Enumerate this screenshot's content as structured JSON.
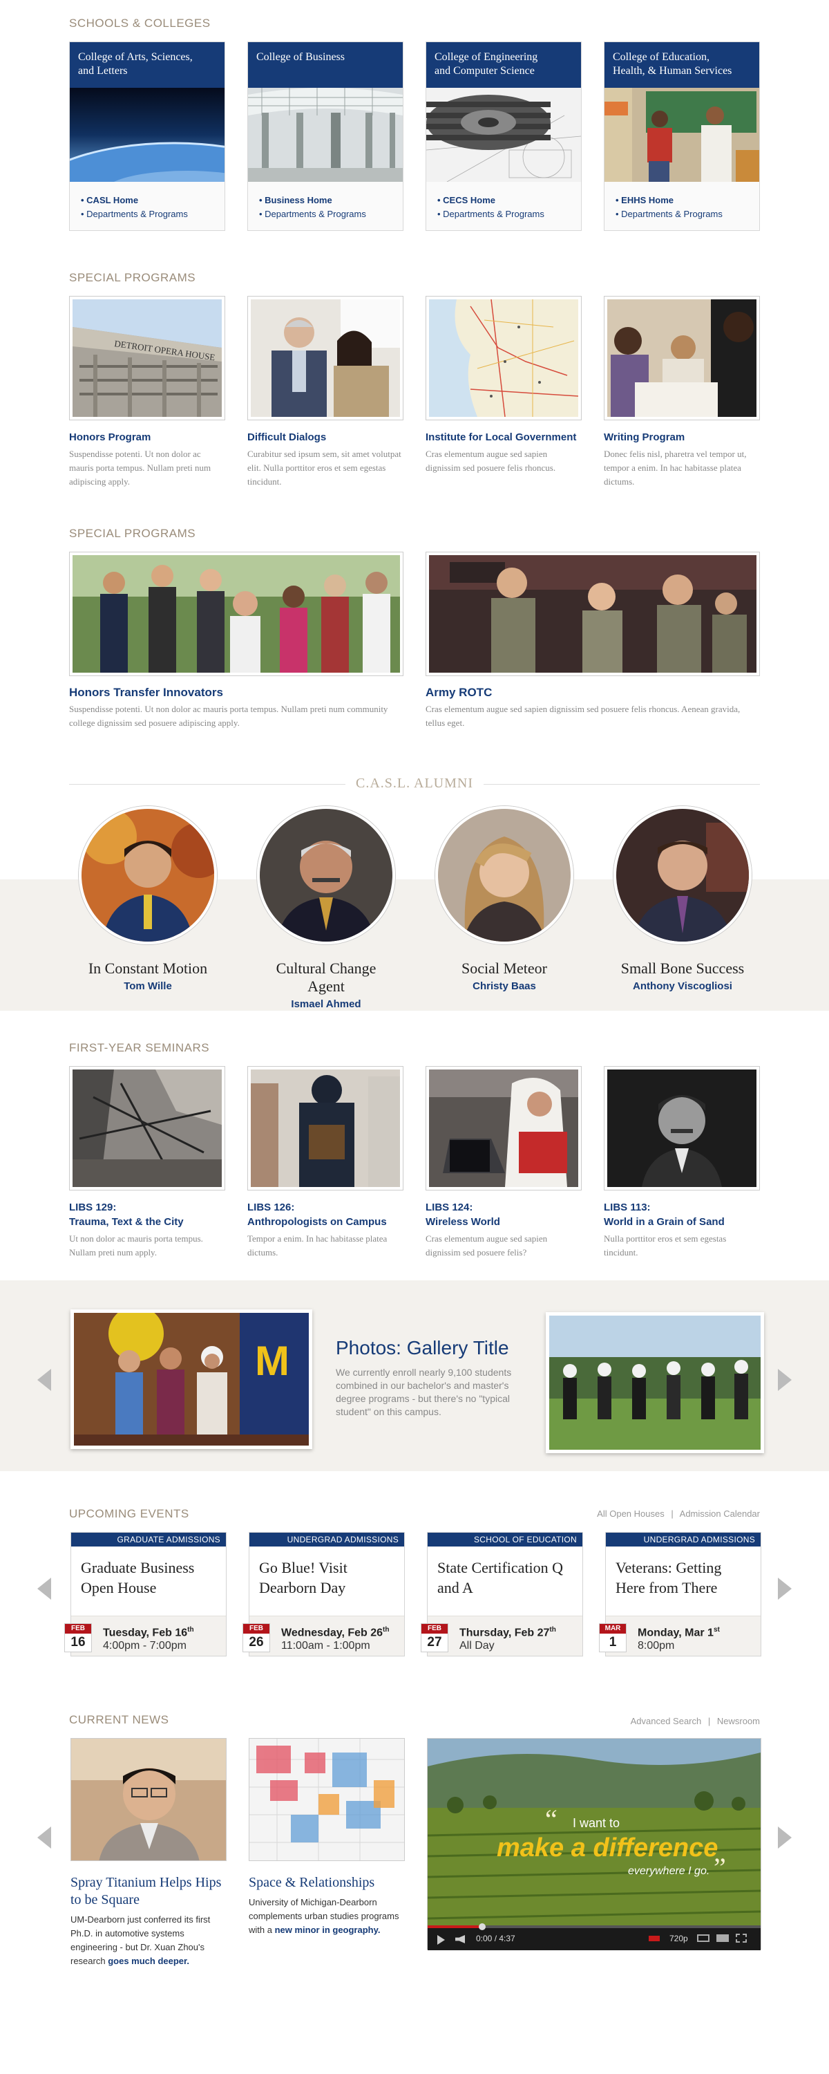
{
  "schools": {
    "label": "SCHOOLS & COLLEGES",
    "items": [
      {
        "title_line1": "College of Arts, Sciences,",
        "title_line2": "and Letters",
        "home": "CASL Home",
        "dept": "Departments & Programs"
      },
      {
        "title_line1": "College of Business",
        "title_line2": "",
        "home": "Business Home",
        "dept": "Departments & Programs"
      },
      {
        "title_line1": "College of Engineering",
        "title_line2": "and Computer Science",
        "home": "CECS Home",
        "dept": "Departments & Programs"
      },
      {
        "title_line1": "College of Education,",
        "title_line2": "Health, & Human Services",
        "home": "EHHS Home",
        "dept": "Departments & Programs"
      }
    ]
  },
  "special1": {
    "label": "SPECIAL PROGRAMS",
    "items": [
      {
        "title": "Honors Program",
        "desc": "Suspendisse potenti. Ut non dolor ac mauris porta tempus. Nullam preti num adipiscing apply."
      },
      {
        "title": "Difficult Dialogs",
        "desc": "Curabitur sed ipsum sem, sit amet volutpat elit. Nulla porttitor eros et sem egestas tincidunt."
      },
      {
        "title": "Institute for Local Government",
        "desc": "Cras elementum augue sed sapien dignissim sed posuere felis rhoncus."
      },
      {
        "title": "Writing Program",
        "desc": "Donec felis nisl, pharetra vel tempor ut, tempor a enim. In hac habitasse platea dictums."
      }
    ],
    "photo_sign": "DETROIT OPERA HOUSE"
  },
  "special2": {
    "label": "SPECIAL PROGRAMS",
    "items": [
      {
        "title": "Honors Transfer Innovators",
        "desc": "Suspendisse potenti. Ut non dolor ac mauris porta tempus. Nullam preti num community college dignissim sed posuere adipiscing apply."
      },
      {
        "title": "Army ROTC",
        "desc": "Cras elementum augue sed sapien dignissim sed posuere felis rhoncus. Aenean gravida, tellus eget."
      }
    ]
  },
  "alumni": {
    "label": "C.A.S.L. ALUMNI",
    "items": [
      {
        "title": "In Constant Motion",
        "name": "Tom Wille"
      },
      {
        "title": "Cultural Change Agent",
        "name": "Ismael Ahmed"
      },
      {
        "title": "Social Meteor",
        "name": "Christy Baas"
      },
      {
        "title": "Small Bone Success",
        "name": "Anthony Viscogliosi"
      }
    ]
  },
  "seminars": {
    "label": "FIRST-YEAR SEMINARS",
    "items": [
      {
        "code": "LIBS 129:",
        "title": "Trauma, Text & the City",
        "desc": "Ut non dolor ac mauris porta tempus. Nullam preti num apply."
      },
      {
        "code": "LIBS 126:",
        "title": "Anthropologists on Campus",
        "desc": "Tempor a enim. In hac habitasse platea dictums."
      },
      {
        "code": "LIBS 124:",
        "title": "Wireless World",
        "desc": "Cras elementum augue sed sapien dignissim sed posuere felis?"
      },
      {
        "code": "LIBS 113:",
        "title": "World in a Grain of Sand",
        "desc": "Nulla porttitor eros et sem egestas tincidunt."
      }
    ]
  },
  "gallery": {
    "title": "Photos: Gallery Title",
    "desc": "We currently enroll nearly 9,100 students combined in our bachelor's and master's degree programs - but there's no \"typical student\" on this campus."
  },
  "events": {
    "label": "UPCOMING EVENTS",
    "link1": "All Open Houses",
    "link2": "Admission Calendar",
    "separator": "|",
    "items": [
      {
        "category": "GRADUATE ADMISSIONS",
        "title": "Graduate Business Open House",
        "month": "FEB",
        "day": "16",
        "date": "Tuesday, Feb 16",
        "sup": "th",
        "time": "4:00pm - 7:00pm"
      },
      {
        "category": "UNDERGRAD ADMISSIONS",
        "title": "Go Blue! Visit Dearborn Day",
        "month": "FEB",
        "day": "26",
        "date": "Wednesday, Feb 26",
        "sup": "th",
        "time": "11:00am - 1:00pm"
      },
      {
        "category": "SCHOOL OF EDUCATION",
        "title": "State Certification Q and A",
        "month": "FEB",
        "day": "27",
        "date": "Thursday, Feb 27",
        "sup": "th",
        "time": "All Day"
      },
      {
        "category": "UNDERGRAD ADMISSIONS",
        "title": "Veterans: Getting Here from There",
        "month": "MAR",
        "day": "1",
        "date": "Monday, Mar 1",
        "sup": "st",
        "time": "8:00pm"
      }
    ]
  },
  "news": {
    "label": "CURRENT NEWS",
    "link1": "Advanced Search",
    "link2": "Newsroom",
    "separator": "|",
    "items": [
      {
        "title": "Spray Titanium Helps Hips to be Square",
        "desc": "UM-Dearborn just conferred its first Ph.D. in automotive systems engineering - but Dr. Xuan Zhou's research",
        "link": "goes much deeper."
      },
      {
        "title": "Space & Relationships",
        "desc": "University of Michigan-Dearborn complements urban studies programs with a",
        "link": "new minor in geography."
      }
    ],
    "video": {
      "quote_open": "“",
      "line1": "I want to",
      "line2": "make a difference",
      "line3": "everywhere I go.",
      "quote_close": "”",
      "time": "0:00 / 4:37",
      "quality": "720p"
    }
  },
  "colors": {
    "navy": "#163b77",
    "tan": "#9a8c7a",
    "band": "#f3f1ed",
    "red": "#b3151b"
  }
}
